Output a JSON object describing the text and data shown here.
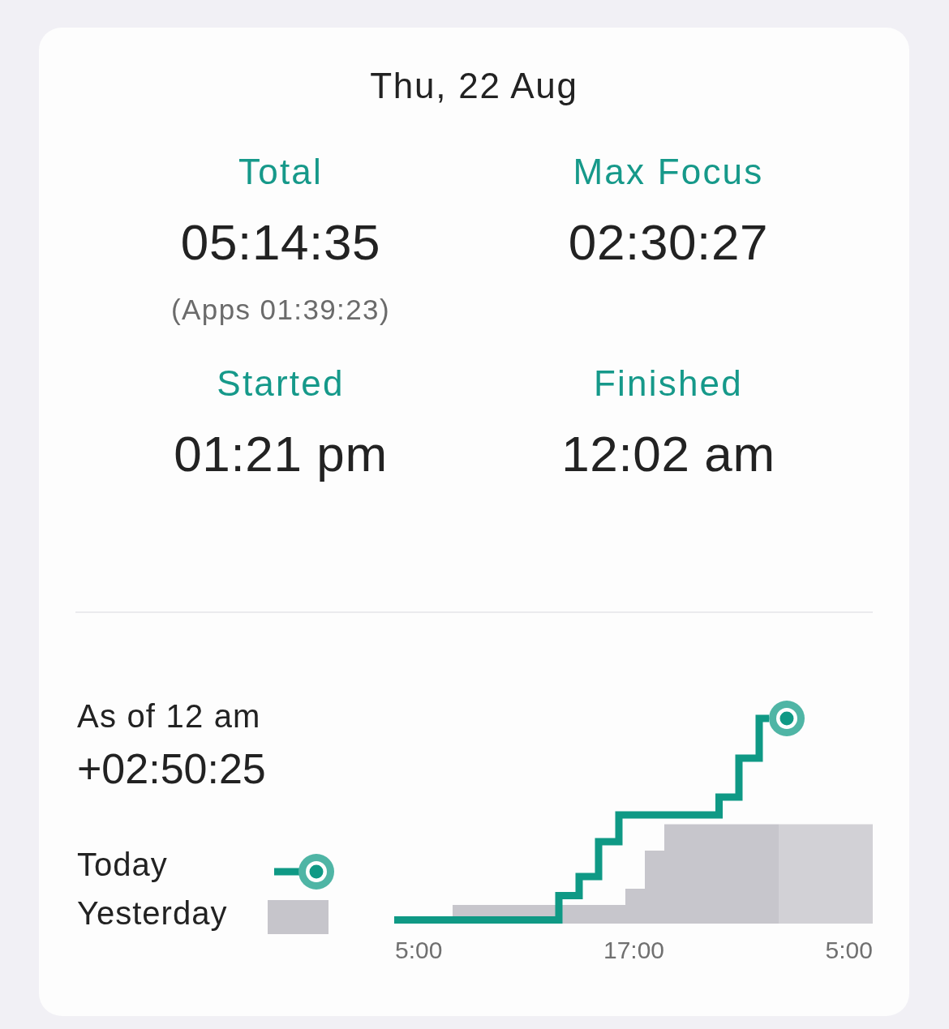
{
  "date": "Thu, 22 Aug",
  "stats": [
    {
      "label": "Total",
      "value": "05:14:35",
      "note": "(Apps 01:39:23)"
    },
    {
      "label": "Max Focus",
      "value": "02:30:27"
    },
    {
      "label": "Started",
      "value": "01:21 pm"
    },
    {
      "label": "Finished",
      "value": "12:02 am"
    }
  ],
  "comparison": {
    "caption": "As of 12 am",
    "difference": "+02:50:25"
  },
  "legend": [
    {
      "label": "Today",
      "kind": "line"
    },
    {
      "label": "Yesterday",
      "kind": "area"
    }
  ],
  "chart": {
    "x_labels": [
      "5:00",
      "17:00",
      "5:00"
    ]
  }
}
